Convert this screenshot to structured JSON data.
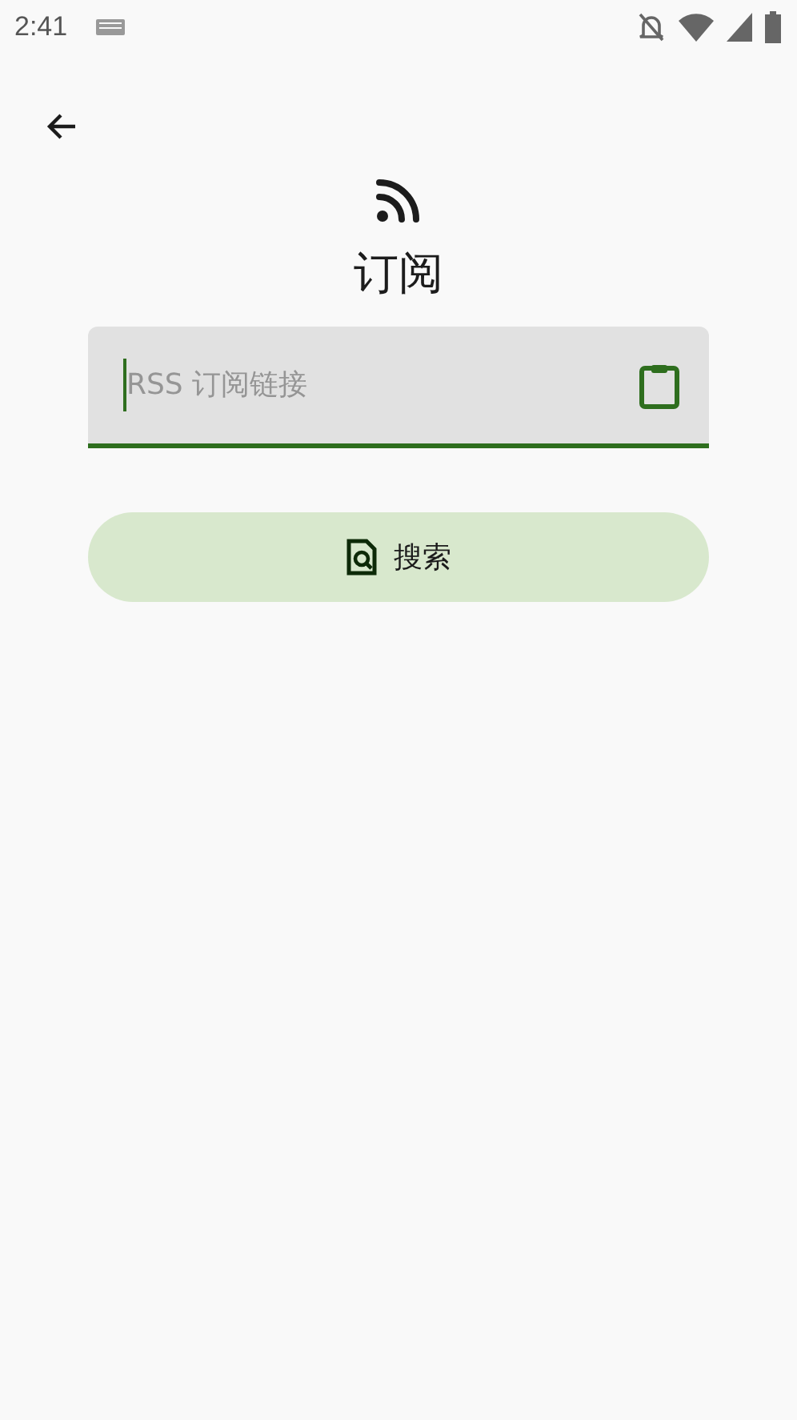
{
  "status_bar": {
    "time": "2:41"
  },
  "title": "订阅",
  "url_field": {
    "placeholder": "RSS 订阅链接",
    "focused": true
  },
  "search_button": {
    "label": "搜索"
  }
}
